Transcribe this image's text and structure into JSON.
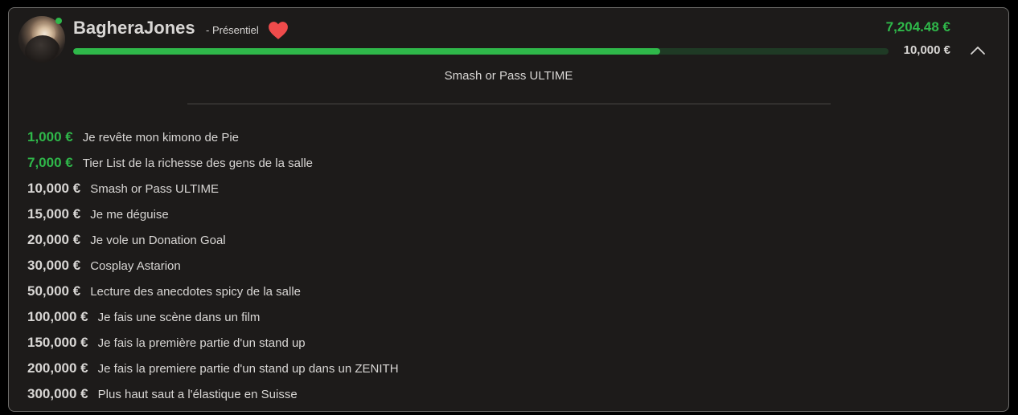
{
  "streamer": {
    "name": "BagheraJones",
    "presence": "- Présentiel",
    "online": true,
    "heart_icon": "heart-icon"
  },
  "progress": {
    "current": "7,204.48 €",
    "goal": "10,000 €",
    "fraction": 0.7204,
    "current_goal_label": "Smash or Pass ULTIME"
  },
  "colors": {
    "accent": "#2fb84a",
    "heart": "#ef4b4b",
    "card_bg": "#1d1b1a",
    "text": "#d8d6d4"
  },
  "goals": [
    {
      "amount": "1,000 €",
      "label": "Je revête mon kimono de Pie",
      "reached": true
    },
    {
      "amount": "7,000 €",
      "label": "Tier List de la richesse des gens de la salle",
      "reached": true
    },
    {
      "amount": "10,000 €",
      "label": "Smash or Pass ULTIME",
      "reached": false
    },
    {
      "amount": "15,000 €",
      "label": "Je me déguise",
      "reached": false
    },
    {
      "amount": "20,000 €",
      "label": "Je vole un Donation Goal",
      "reached": false
    },
    {
      "amount": "30,000 €",
      "label": "Cosplay Astarion",
      "reached": false
    },
    {
      "amount": "50,000 €",
      "label": "Lecture des anecdotes spicy de la salle",
      "reached": false
    },
    {
      "amount": "100,000 €",
      "label": "Je fais une scène dans un film",
      "reached": false
    },
    {
      "amount": "150,000 €",
      "label": "Je fais la première partie d'un stand up",
      "reached": false
    },
    {
      "amount": "200,000 €",
      "label": "Je fais la premiere partie d'un stand up dans un ZENITH",
      "reached": false
    },
    {
      "amount": "300,000 €",
      "label": "Plus haut saut a l'élastique en Suisse",
      "reached": false
    }
  ]
}
